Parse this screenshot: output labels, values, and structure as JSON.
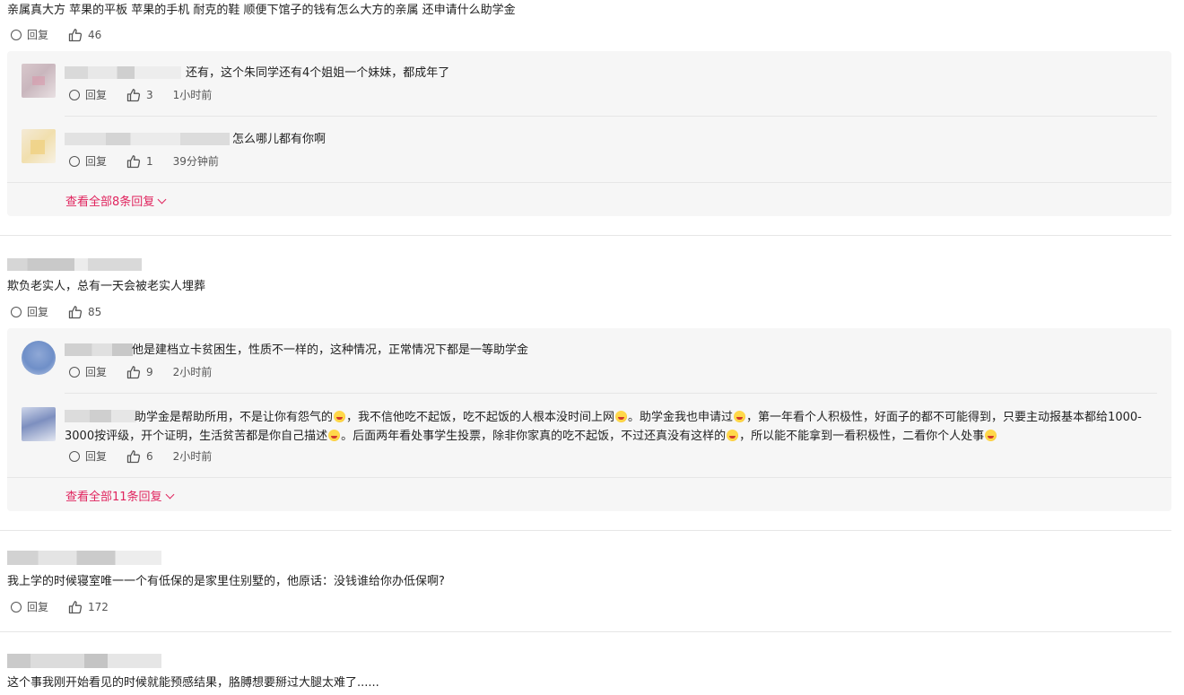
{
  "labels": {
    "reply": "回复"
  },
  "threads": [
    {
      "text": "亲属真大方 苹果的平板 苹果的手机 耐克的鞋 顺便下馆子的钱有怎么大方的亲属 还申请什么助学金",
      "likes": "46",
      "replies": [
        {
          "text": "还有，这个朱同学还有4个姐姐一个妹妹，都成年了",
          "likes": "3",
          "time": "1小时前"
        },
        {
          "text": "怎么哪儿都有你啊",
          "likes": "1",
          "time": "39分钟前"
        }
      ],
      "more": "查看全部8条回复"
    },
    {
      "text": "欺负老实人，总有一天会被老实人埋葬",
      "likes": "85",
      "replies": [
        {
          "text": "他是建档立卡贫困生，性质不一样的，这种情况，正常情况下都是一等助学金",
          "likes": "9",
          "time": "2小时前"
        },
        {
          "segments": [
            "助学金是帮助所用，不是让你有怨气的",
            "，我不信他吃不起饭，吃不起饭的人根本没时间上网",
            "。助学金我也申请过",
            "，第一年看个人积极性，好面子的都不可能得到，只要主动报基本都给1000-3000按评级，开个证明，生活贫苦都是你自己描述",
            "。后面两年看处事学生投票，除非你家真的吃不起饭，不过还真没有这样的",
            "，所以能不能拿到一看积极性，二看你个人处事"
          ],
          "likes": "6",
          "time": "2小时前"
        }
      ],
      "more": "查看全部11条回复"
    },
    {
      "text": "我上学的时候寝室唯一一个有低保的是家里住别墅的，他原话：没钱谁给你办低保啊?",
      "likes": "172"
    },
    {
      "text": "这个事我刚开始看见的时候就能预感结果，胳膊想要掰过大腿太难了......"
    }
  ]
}
